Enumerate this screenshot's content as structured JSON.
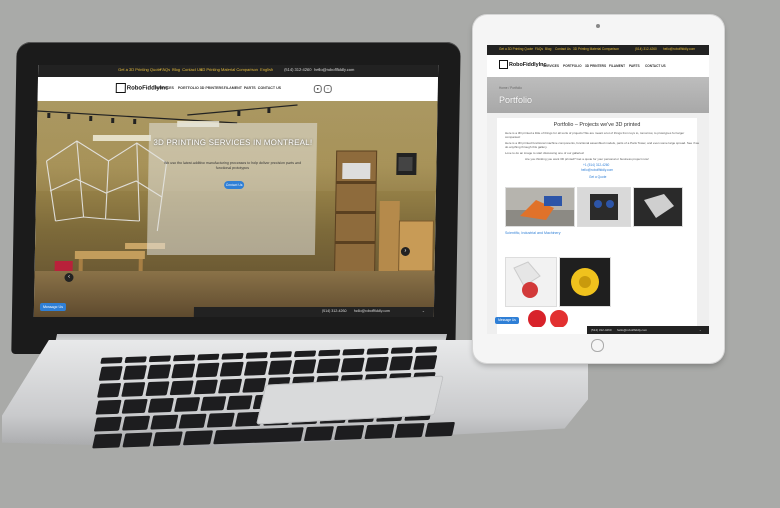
{
  "site": {
    "brand": "RoboFiddly",
    "brand_suffix": "Inc",
    "top_links": [
      "Get a 3D Printing Quote",
      "FAQs",
      "Blog",
      "Contact Us",
      "3D Printing Material Comparison"
    ],
    "language": "English",
    "phone": "(514) 312-4260",
    "email": "hello@roboflfiddly.com",
    "nav": [
      "SERVICES",
      "PORTFOLIO",
      "3D PRINTERS",
      "FILAMENT",
      "PARTS",
      "CONTACT US"
    ],
    "messenger": "Message Us"
  },
  "laptop": {
    "hero_title": "3D PRINTING SERVICES IN MONTREAL!",
    "hero_text": "We use the latest additive manufacturing processes to help deliver precision parts and functional prototypes",
    "hero_button": "Contact Us",
    "prev_arrow": "‹",
    "next_arrow": "›",
    "footer_phone": "(514) 312-4260",
    "footer_email": "hello@roboflfiddly.com"
  },
  "tablet": {
    "breadcrumb": "Home  /  Portfolio",
    "page_title": "Portfolio",
    "section_heading": "Portfolio – Projects we've 3D printed",
    "paragraphs": [
      "Here is a 3D printed a little of things for all sorts of projects! We are meant a lot of things from toys to, tomorrow, to prototypes for larger",
      "companies!",
      "Here is a 3D printed functional machine components, functional assembled models, parts of a Paris Tower, and even some large spread. See if we",
      "do anything through this gallery.",
      "Love to do an image to start discussing one of our galleries!",
      "Are you thinking you want 3D printed? Get a quote for your personal or business project now!"
    ],
    "contact_phone": "+1 (514) 312-4260",
    "contact_email": "hello@roboflfiddly.com",
    "quote_link": "Get a Quote",
    "gallery_caption": "Scientific, Industrial and Machinery",
    "footer_phone": "(514) 312-4260",
    "footer_email": "hello@roboflfiddly.com"
  },
  "colors": {
    "accent": "#2f7fd6",
    "topbar": "#222222",
    "link_gold": "#e2b93b"
  }
}
